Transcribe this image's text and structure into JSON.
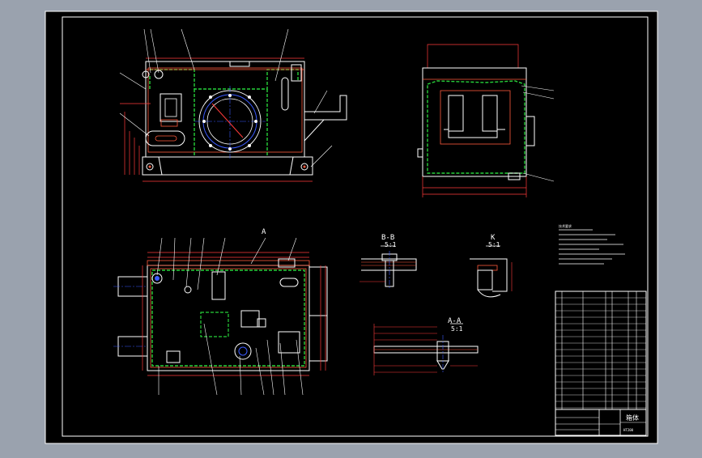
{
  "colors": {
    "frame": "#9aa2ae",
    "sheet": "#000000",
    "line": "#ffffff",
    "part": "#ff5a3c",
    "hidden": "#27d13a",
    "dim": "#ff3b3b",
    "center": "#3b5bff",
    "text": "#ffffff"
  },
  "labels": {
    "section_bb": "B-B",
    "section_bb_scale": "5:1",
    "view_k": "K",
    "view_k_scale": "5:1",
    "section_aa": "A-A",
    "section_aa_scale": "5:1",
    "view_letter_a": "A",
    "notes_title": "技术要求",
    "title_block_name": "箱体",
    "title_block_sub": "HT200"
  }
}
